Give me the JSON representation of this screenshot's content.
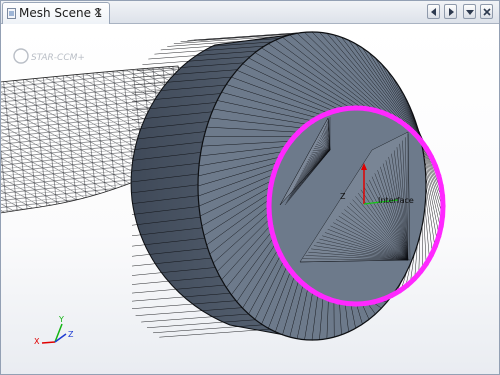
{
  "tab": {
    "title": "Mesh Scene 1",
    "close_glyph": "×",
    "icon": "scene-icon"
  },
  "tab_nav": {
    "prev_icon": "chevron-left-icon",
    "next_icon": "chevron-right-icon",
    "menu_icon": "chevron-down-icon",
    "close_icon": "close-icon"
  },
  "scene": {
    "logo": "STAR-CCM+",
    "triad_labels": {
      "x": "X",
      "y": "Y",
      "z": "Z"
    },
    "local_axis_label": "Interface",
    "colors": {
      "face": "#6d7a8b",
      "side": "#505c6b",
      "edge": "#0d0f12",
      "highlight": "#ff28ff",
      "pipe": "#ffffff"
    }
  }
}
